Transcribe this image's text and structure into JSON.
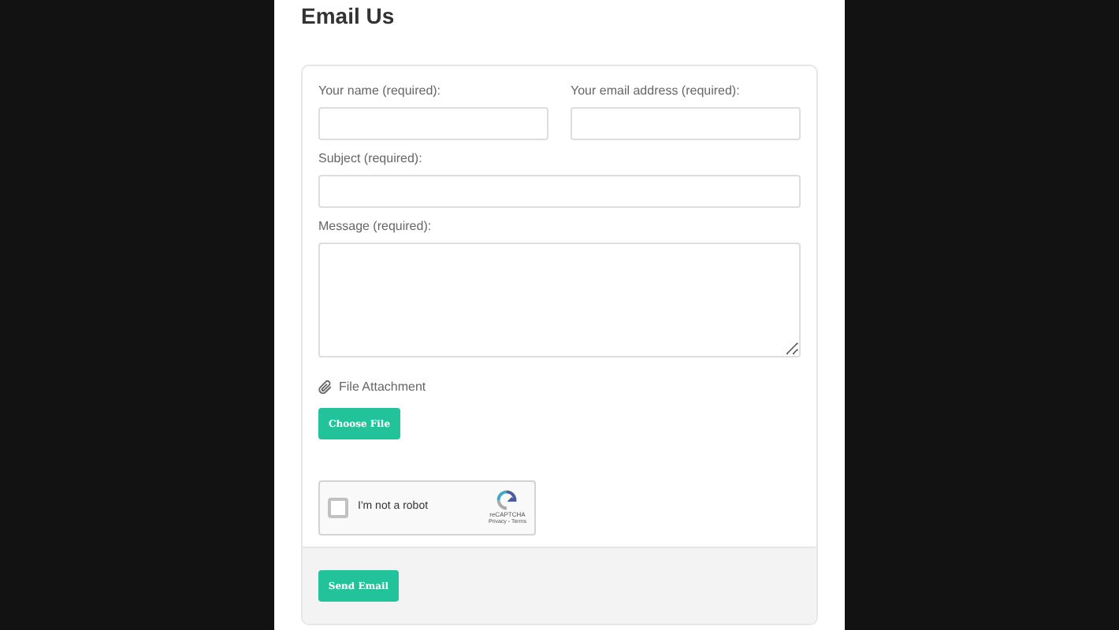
{
  "title": "Email Us",
  "fields": [
    {
      "label": "Your name (required):",
      "kind": "input"
    },
    {
      "label": "Your email address (required):",
      "kind": "input"
    },
    {
      "label": "Subject (required):",
      "kind": "input"
    },
    {
      "label": "Message (required):",
      "kind": "textarea"
    }
  ],
  "attachment": {
    "label": "File Attachment",
    "button": "Choose File"
  },
  "captcha": {
    "label": "I'm not a robot",
    "checked": false,
    "brand": "reCAPTCHA",
    "links": "Privacy - Terms"
  },
  "submit": "Send Email"
}
